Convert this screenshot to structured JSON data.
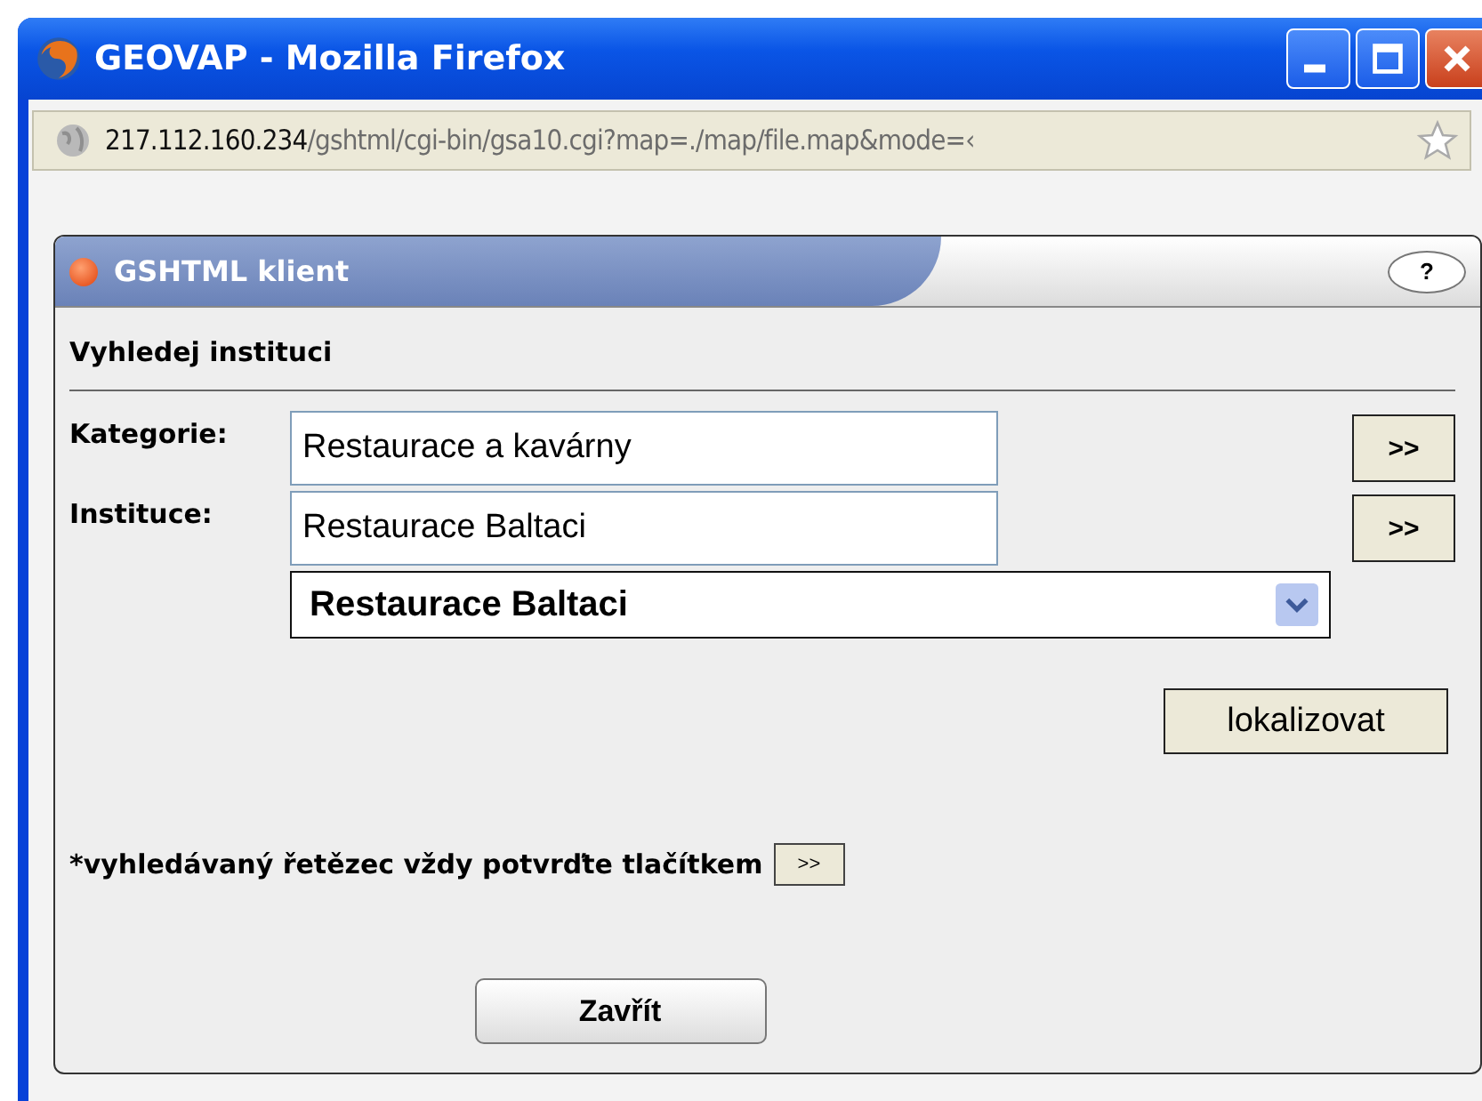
{
  "window": {
    "title": "GEOVAP - Mozilla Firefox"
  },
  "address_bar": {
    "host": "217.112.160.234",
    "path": "/gshtml/cgi-bin/gsa10.cgi?map=./map/file.map&mode=‹"
  },
  "panel": {
    "title": "GSHTML klient",
    "help": "?",
    "heading": "Vyhledej instituci",
    "fields": [
      {
        "label": "Kategorie:",
        "value": "Restaurace a kavárny",
        "button": ">>"
      },
      {
        "label": "Instituce:",
        "value": "Restaurace Baltaci",
        "button": ">>"
      }
    ],
    "select": {
      "value": "Restaurace Baltaci"
    },
    "locate_button": "lokalizovat",
    "note": "*vyhledávaný řetězec vždy potvrďte tlačítkem",
    "note_button": ">>",
    "close_button": "Zavřít"
  }
}
